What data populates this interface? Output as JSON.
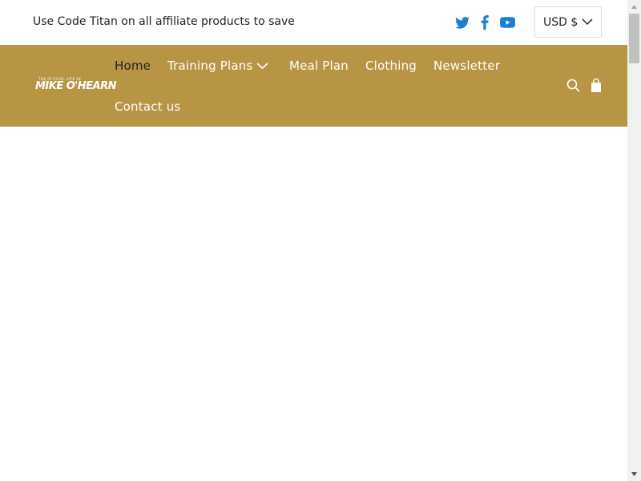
{
  "announcement": {
    "text": "Use Code Titan on all affiliate products to save"
  },
  "social": {
    "icons": [
      "twitter-icon",
      "facebook-icon",
      "youtube-icon"
    ],
    "color": "#1a7fd4"
  },
  "currency": {
    "selected": "USD $"
  },
  "header": {
    "background": "#b79545",
    "logo": {
      "small_text": "THE OFFICIAL SITE OF",
      "main_text": "MIKE O'HEARN"
    },
    "nav": [
      {
        "label": "Home",
        "active": true
      },
      {
        "label": "Training Plans",
        "has_dropdown": true
      },
      {
        "label": "Meal Plan"
      },
      {
        "label": "Clothing"
      },
      {
        "label": "Newsletter"
      },
      {
        "label": "Contact us"
      }
    ],
    "icons": [
      "search-icon",
      "shopping-bag-icon"
    ]
  }
}
